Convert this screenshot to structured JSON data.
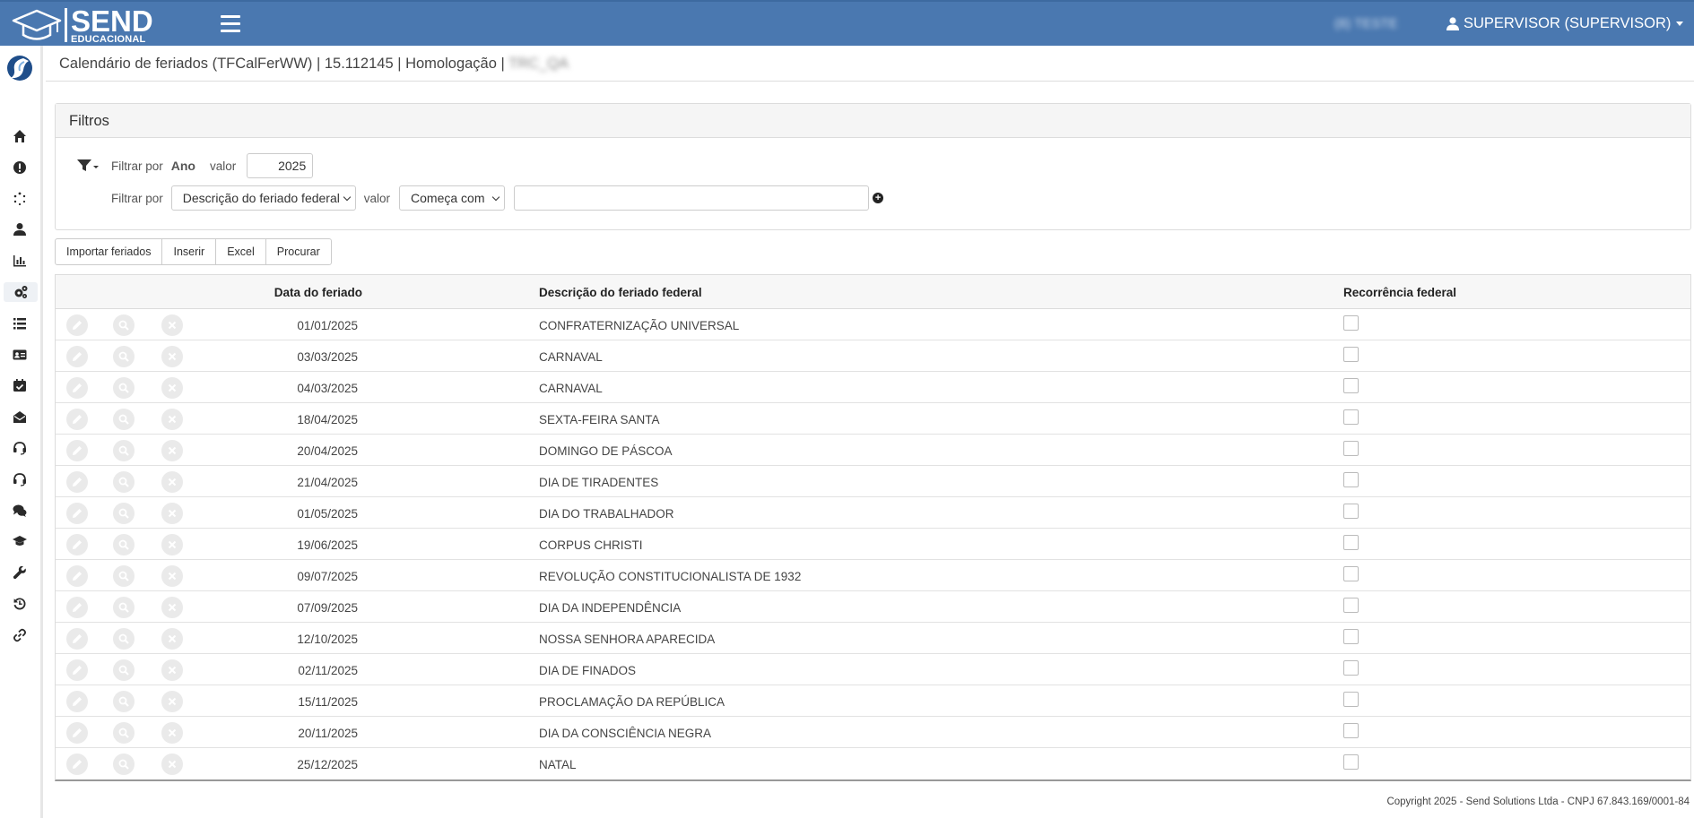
{
  "header": {
    "logo_main": "SEND",
    "logo_sub": "EDUCACIONAL",
    "tenant": "(8) TESTE",
    "user": "SUPERVISOR (SUPERVISOR)"
  },
  "sidebar": {
    "items": [
      "home-icon",
      "alert-icon",
      "spinner-icon",
      "user-icon",
      "chart-icon",
      "cogs-icon",
      "list-icon",
      "id-card-icon",
      "calendar-check-icon",
      "envelope-open-icon",
      "headset-icon",
      "headset-icon",
      "comments-icon",
      "graduation-cap-icon",
      "wrench-icon",
      "history-icon",
      "link-icon"
    ],
    "active_index": 5
  },
  "page": {
    "title": "Calendário de feriados (TFCalFerWW) | 15.112145 | Homologação |",
    "env": "TRC_QA"
  },
  "filters": {
    "heading": "Filtros",
    "row1": {
      "label": "Filtrar por",
      "field": "Ano",
      "value_label": "valor",
      "value": "2025"
    },
    "row2": {
      "label": "Filtrar por",
      "field": "Descrição do feriado federal",
      "value_label": "valor",
      "operator": "Começa com",
      "value": ""
    }
  },
  "toolbar": {
    "import": "Importar feriados",
    "insert": "Inserir",
    "excel": "Excel",
    "search": "Procurar"
  },
  "table": {
    "columns": [
      "Data do feriado",
      "Descrição do feriado federal",
      "Recorrência federal"
    ],
    "rows": [
      {
        "date": "01/01/2025",
        "desc": "CONFRATERNIZAÇÃO UNIVERSAL",
        "recurrent": false
      },
      {
        "date": "03/03/2025",
        "desc": "CARNAVAL",
        "recurrent": false
      },
      {
        "date": "04/03/2025",
        "desc": "CARNAVAL",
        "recurrent": false
      },
      {
        "date": "18/04/2025",
        "desc": "SEXTA-FEIRA SANTA",
        "recurrent": false
      },
      {
        "date": "20/04/2025",
        "desc": "DOMINGO DE PÁSCOA",
        "recurrent": false
      },
      {
        "date": "21/04/2025",
        "desc": "DIA DE TIRADENTES",
        "recurrent": false
      },
      {
        "date": "01/05/2025",
        "desc": "DIA DO TRABALHADOR",
        "recurrent": false
      },
      {
        "date": "19/06/2025",
        "desc": "CORPUS CHRISTI",
        "recurrent": false
      },
      {
        "date": "09/07/2025",
        "desc": "REVOLUÇÃO CONSTITUCIONALISTA DE 1932",
        "recurrent": false
      },
      {
        "date": "07/09/2025",
        "desc": "DIA DA INDEPENDÊNCIA",
        "recurrent": false
      },
      {
        "date": "12/10/2025",
        "desc": "NOSSA SENHORA APARECIDA",
        "recurrent": false
      },
      {
        "date": "02/11/2025",
        "desc": "DIA DE FINADOS",
        "recurrent": false
      },
      {
        "date": "15/11/2025",
        "desc": "PROCLAMAÇÃO DA REPÚBLICA",
        "recurrent": false
      },
      {
        "date": "20/11/2025",
        "desc": "DIA DA CONSCIÊNCIA NEGRA",
        "recurrent": false
      },
      {
        "date": "25/12/2025",
        "desc": "NATAL",
        "recurrent": false
      }
    ]
  },
  "footer": "Copyright 2025 - Send Solutions Ltda - CNPJ 67.843.169/0001-84",
  "colors": {
    "header": "#4a78b0",
    "icon_btn": "#eaeaea"
  }
}
